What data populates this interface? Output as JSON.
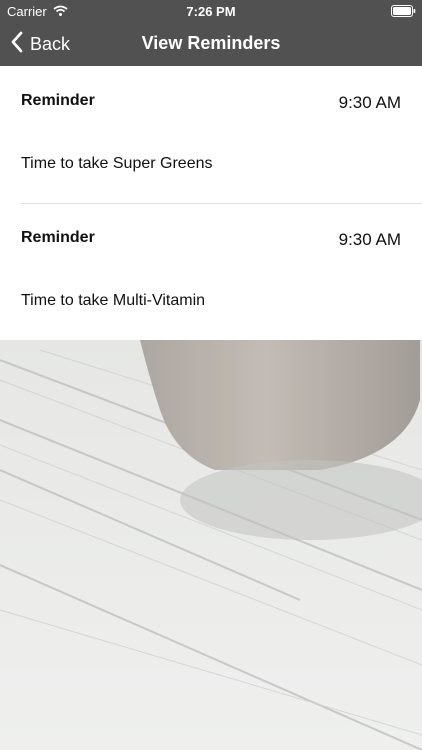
{
  "status_bar": {
    "carrier": "Carrier",
    "time": "7:26 PM"
  },
  "nav": {
    "back_label": "Back",
    "title": "View Reminders"
  },
  "reminders": [
    {
      "title": "Reminder",
      "time": "9:30 AM",
      "message": "Time to take Super Greens"
    },
    {
      "title": "Reminder",
      "time": "9:30 AM",
      "message": "Time to take Multi-Vitamin"
    }
  ],
  "colors": {
    "nav_bar": "#515151",
    "card": "#ffffff",
    "text": "#111111"
  },
  "icons": {
    "wifi": "wifi-icon",
    "battery": "battery-icon",
    "back": "chevron-left-icon"
  }
}
